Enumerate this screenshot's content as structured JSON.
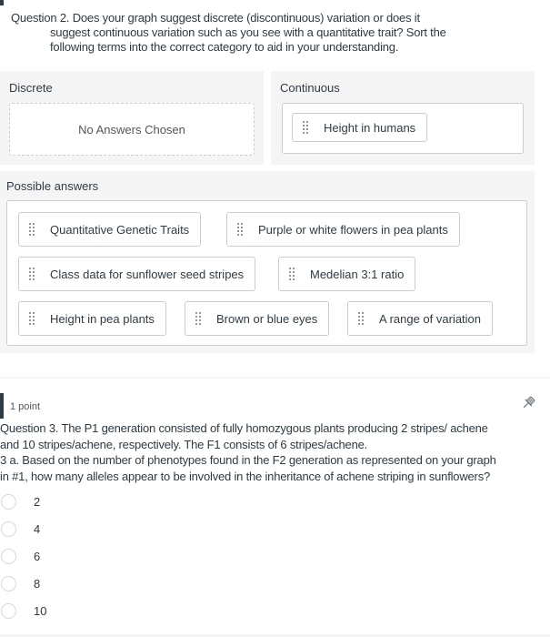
{
  "question2": {
    "line1": "Question 2. Does your graph suggest discrete (discontinuous) variation or does it",
    "line2": "suggest continuous variation such as you see with a quantitative trait? Sort the",
    "line3": "following terms into the correct category to aid in your understanding.",
    "categories": {
      "discrete": {
        "label": "Discrete",
        "empty_text": "No Answers Chosen"
      },
      "continuous": {
        "label": "Continuous",
        "items": [
          "Height in humans"
        ]
      }
    },
    "possible_answers": {
      "label": "Possible answers",
      "items": [
        "Quantitative Genetic Traits",
        "Purple or white flowers in pea plants",
        "Class data for sunflower seed stripes",
        "Medelian 3:1 ratio",
        "Height in pea plants",
        "Brown or blue eyes",
        "A range of variation"
      ]
    }
  },
  "question3": {
    "points": "1 point",
    "pin_icon": "pushpin-icon",
    "line1": "Question 3. The P1 generation consisted of fully homozygous plants producing 2 stripes/ achene",
    "line2": "and 10 stripes/achene, respectively. The F1 consists of 6 stripes/achene.",
    "line3": "3 a. Based on the number of phenotypes found in the F2 generation as represented on your graph",
    "line4": "in #1, how many alleles appear to be involved in the inheritance of achene striping in sunflowers?",
    "options": [
      "2",
      "4",
      "6",
      "8",
      "10"
    ],
    "selected": null
  },
  "colors": {
    "text": "#2d3b45",
    "zone_bg": "#f5f5f5",
    "border": "#c7cdd1",
    "accent_bar": "#2d3b45"
  }
}
